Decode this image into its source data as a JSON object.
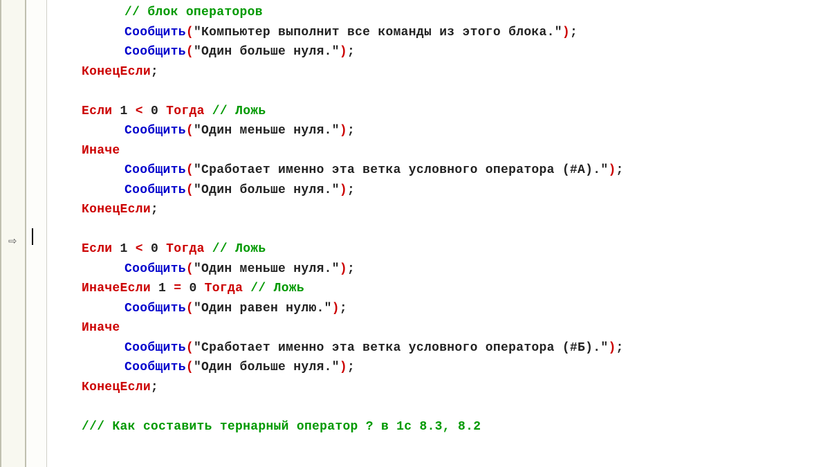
{
  "gutter": {
    "marker": "⇨"
  },
  "code": {
    "lines": [
      {
        "indent": 2,
        "tokens": [
          {
            "cls": "cmt",
            "t": "// блок операторов"
          }
        ]
      },
      {
        "indent": 2,
        "tokens": [
          {
            "cls": "fn",
            "t": "Сообщить"
          },
          {
            "cls": "paren",
            "t": "("
          },
          {
            "cls": "str",
            "t": "\"Компьютер выполнит все команды из этого блока.\""
          },
          {
            "cls": "paren",
            "t": ")"
          },
          {
            "cls": "semi",
            "t": ";"
          }
        ]
      },
      {
        "indent": 2,
        "tokens": [
          {
            "cls": "fn",
            "t": "Сообщить"
          },
          {
            "cls": "paren",
            "t": "("
          },
          {
            "cls": "str",
            "t": "\"Один больше нуля.\""
          },
          {
            "cls": "paren",
            "t": ")"
          },
          {
            "cls": "semi",
            "t": ";"
          }
        ]
      },
      {
        "indent": 1,
        "tokens": [
          {
            "cls": "kw",
            "t": "КонецЕсли"
          },
          {
            "cls": "semi",
            "t": ";"
          }
        ]
      },
      {
        "indent": 0,
        "tokens": []
      },
      {
        "indent": 1,
        "tokens": [
          {
            "cls": "kw",
            "t": "Если"
          },
          {
            "cls": "num",
            "t": " 1 "
          },
          {
            "cls": "op",
            "t": "<"
          },
          {
            "cls": "num",
            "t": " 0 "
          },
          {
            "cls": "kw",
            "t": "Тогда"
          },
          {
            "cls": "num",
            "t": " "
          },
          {
            "cls": "cmt",
            "t": "// Ложь"
          }
        ]
      },
      {
        "indent": 2,
        "tokens": [
          {
            "cls": "fn",
            "t": "Сообщить"
          },
          {
            "cls": "paren",
            "t": "("
          },
          {
            "cls": "str",
            "t": "\"Один меньше нуля.\""
          },
          {
            "cls": "paren",
            "t": ")"
          },
          {
            "cls": "semi",
            "t": ";"
          }
        ]
      },
      {
        "indent": 1,
        "tokens": [
          {
            "cls": "kw",
            "t": "Иначе"
          }
        ]
      },
      {
        "indent": 2,
        "tokens": [
          {
            "cls": "fn",
            "t": "Сообщить"
          },
          {
            "cls": "paren",
            "t": "("
          },
          {
            "cls": "str",
            "t": "\"Сработает именно эта ветка условного оператора (#А).\""
          },
          {
            "cls": "paren",
            "t": ")"
          },
          {
            "cls": "semi",
            "t": ";"
          }
        ]
      },
      {
        "indent": 2,
        "tokens": [
          {
            "cls": "fn",
            "t": "Сообщить"
          },
          {
            "cls": "paren",
            "t": "("
          },
          {
            "cls": "str",
            "t": "\"Один больше нуля.\""
          },
          {
            "cls": "paren",
            "t": ")"
          },
          {
            "cls": "semi",
            "t": ";"
          }
        ]
      },
      {
        "indent": 1,
        "tokens": [
          {
            "cls": "kw",
            "t": "КонецЕсли"
          },
          {
            "cls": "semi",
            "t": ";"
          }
        ]
      },
      {
        "indent": 0,
        "tokens": []
      },
      {
        "indent": 1,
        "tokens": [
          {
            "cls": "kw",
            "t": "Если"
          },
          {
            "cls": "num",
            "t": " 1 "
          },
          {
            "cls": "op",
            "t": "<"
          },
          {
            "cls": "num",
            "t": " 0 "
          },
          {
            "cls": "kw",
            "t": "Тогда"
          },
          {
            "cls": "num",
            "t": " "
          },
          {
            "cls": "cmt",
            "t": "// Ложь"
          }
        ]
      },
      {
        "indent": 2,
        "tokens": [
          {
            "cls": "fn",
            "t": "Сообщить"
          },
          {
            "cls": "paren",
            "t": "("
          },
          {
            "cls": "str",
            "t": "\"Один меньше нуля.\""
          },
          {
            "cls": "paren",
            "t": ")"
          },
          {
            "cls": "semi",
            "t": ";"
          }
        ]
      },
      {
        "indent": 1,
        "tokens": [
          {
            "cls": "kw",
            "t": "ИначеЕсли"
          },
          {
            "cls": "num",
            "t": " 1 "
          },
          {
            "cls": "op",
            "t": "="
          },
          {
            "cls": "num",
            "t": " 0 "
          },
          {
            "cls": "kw",
            "t": "Тогда"
          },
          {
            "cls": "num",
            "t": " "
          },
          {
            "cls": "cmt",
            "t": "// Ложь"
          }
        ]
      },
      {
        "indent": 2,
        "tokens": [
          {
            "cls": "fn",
            "t": "Сообщить"
          },
          {
            "cls": "paren",
            "t": "("
          },
          {
            "cls": "str",
            "t": "\"Один равен нулю.\""
          },
          {
            "cls": "paren",
            "t": ")"
          },
          {
            "cls": "semi",
            "t": ";"
          }
        ]
      },
      {
        "indent": 1,
        "tokens": [
          {
            "cls": "kw",
            "t": "Иначе"
          }
        ]
      },
      {
        "indent": 2,
        "tokens": [
          {
            "cls": "fn",
            "t": "Сообщить"
          },
          {
            "cls": "paren",
            "t": "("
          },
          {
            "cls": "str",
            "t": "\"Сработает именно эта ветка условного оператора (#Б).\""
          },
          {
            "cls": "paren",
            "t": ")"
          },
          {
            "cls": "semi",
            "t": ";"
          }
        ]
      },
      {
        "indent": 2,
        "tokens": [
          {
            "cls": "fn",
            "t": "Сообщить"
          },
          {
            "cls": "paren",
            "t": "("
          },
          {
            "cls": "str",
            "t": "\"Один больше нуля.\""
          },
          {
            "cls": "paren",
            "t": ")"
          },
          {
            "cls": "semi",
            "t": ";"
          }
        ]
      },
      {
        "indent": 1,
        "tokens": [
          {
            "cls": "kw",
            "t": "КонецЕсли"
          },
          {
            "cls": "semi",
            "t": ";"
          }
        ]
      },
      {
        "indent": 0,
        "tokens": []
      },
      {
        "indent": 1,
        "tokens": [
          {
            "cls": "cmt",
            "t": "/// Как составить тернарный оператор ? в 1с 8.3, 8.2"
          }
        ]
      }
    ]
  }
}
